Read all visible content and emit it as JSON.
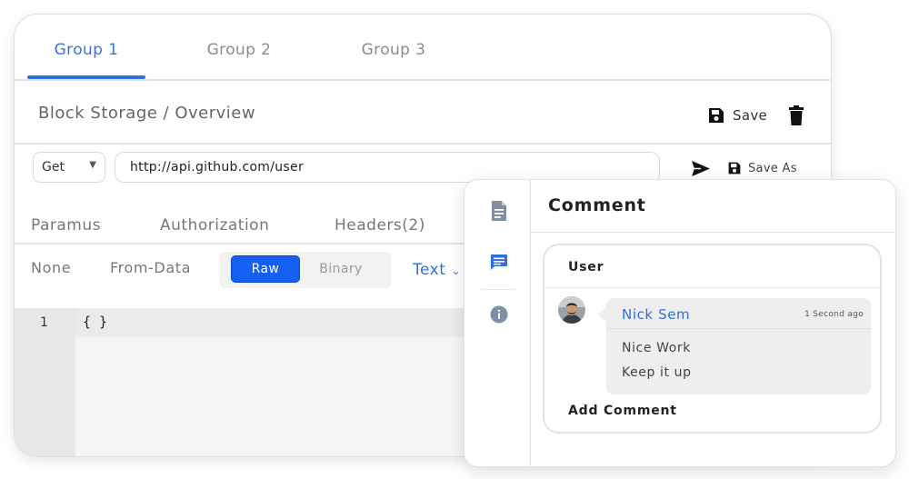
{
  "group_tabs": {
    "tab1": "Group 1",
    "tab2": "Group 2",
    "tab3": "Group 3",
    "active": "Group 1"
  },
  "header": {
    "breadcrumb": "Block Storage / Overview",
    "save_label": "Save"
  },
  "request": {
    "method": "Get",
    "url": "http://api.github.com/user",
    "save_as_label": "Save As"
  },
  "request_tabs": {
    "params": "Paramus",
    "authorization": "Authorization",
    "headers": "Headers(2)"
  },
  "body_types": {
    "none": "None",
    "form_data": "From-Data",
    "raw": "Raw",
    "binary": "Binary",
    "active": "Raw",
    "format": "Text"
  },
  "editor": {
    "line_number": "1",
    "code": "{ }"
  },
  "comment_panel": {
    "title": "Comment",
    "user_label": "User",
    "comment": {
      "author": "Nick Sem",
      "time": "1 Second ago",
      "line1": "Nice Work",
      "line2": "Keep it up"
    },
    "add_comment_label": "Add Comment"
  },
  "colors": {
    "accent_blue": "#2f6fe0",
    "raw_button": "#1460f2",
    "rail_icon": "#7f8fa6",
    "active_rail_icon": "#2f6fe0"
  },
  "icons": [
    "save-icon",
    "trash-icon",
    "send-icon",
    "chevron-down-icon",
    "document-icon",
    "chat-icon",
    "info-icon",
    "avatar"
  ]
}
